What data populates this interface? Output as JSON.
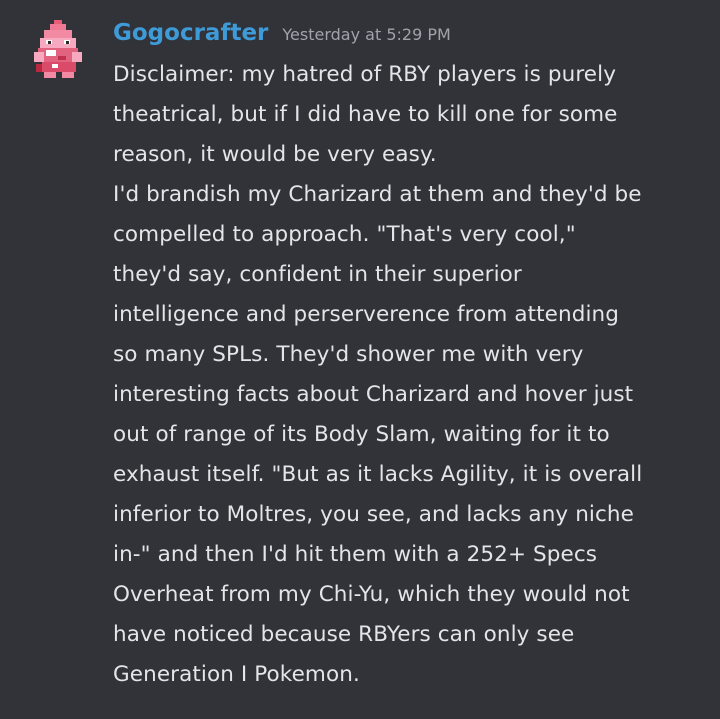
{
  "message": {
    "username": "Gogocrafter",
    "timestamp": "Yesterday at 5:29 PM",
    "username_color": "#3f9bd8",
    "avatar_icon": "pixel-pokemon-avatar",
    "lines": [
      "Disclaimer: my hatred of RBY players is purely",
      "theatrical, but if I did have to kill one for some",
      "reason, it would be very easy.",
      "I'd brandish my Charizard at them and they'd be",
      "compelled to approach. \"That's very cool,\"",
      "they'd say, confident in their superior",
      "intelligence and perserverence from attending",
      "so many SPLs. They'd shower me with very",
      "interesting facts about Charizard and hover just",
      "out of range of its Body Slam, waiting for it to",
      "exhaust itself. \"But as it lacks Agility, it is overall",
      "inferior to Moltres, you see, and lacks any niche",
      "in-\" and then I'd hit them with a 252+ Specs",
      "Overheat from my Chi-Yu, which they would not",
      "have noticed because RBYers can only see",
      "Generation I Pokemon."
    ]
  },
  "colors": {
    "background": "#313338",
    "text": "#e4e5e8",
    "timestamp": "#a0a3ab"
  }
}
